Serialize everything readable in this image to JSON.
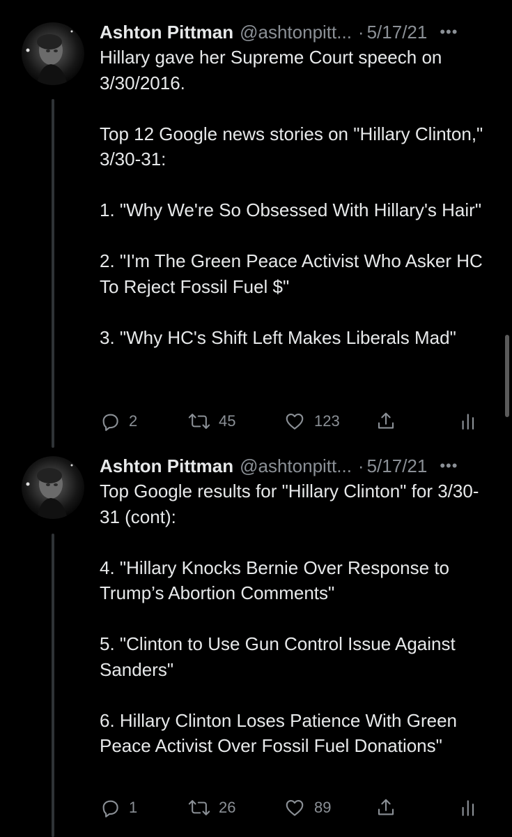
{
  "tweets": [
    {
      "name": "Ashton Pittman",
      "handle": "@ashtonpitt...",
      "separator": "·",
      "date": "5/17/21",
      "more": "•••",
      "paragraphs": [
        "Hillary gave her Supreme Court speech on 3/30/2016.",
        "Top 12 Google news stories on \"Hillary Clinton,\" 3/30-31:",
        "1. \"Why We're So Obsessed With Hillary's Hair\"",
        "2. \"I'm The Green Peace Activist Who Asker HC To Reject Fossil Fuel $\"",
        "3. \"Why HC's Shift Left Makes Liberals Mad\""
      ],
      "replies": "2",
      "retweets": "45",
      "likes": "123"
    },
    {
      "name": "Ashton Pittman",
      "handle": "@ashtonpitt...",
      "separator": "·",
      "date": "5/17/21",
      "more": "•••",
      "paragraphs": [
        "Top Google results for \"Hillary Clinton\" for 3/30-31 (cont):",
        "4. \"Hillary Knocks Bernie Over Response to Trump’s Abortion Comments\"",
        "5. \"Clinton to Use Gun Control Issue Against Sanders\"",
        "6. Hillary Clinton Loses Patience With Green Peace Activist Over Fossil Fuel Donations\""
      ],
      "replies": "1",
      "retweets": "26",
      "likes": "89"
    }
  ],
  "icons": {
    "reply": "reply-icon",
    "retweet": "retweet-icon",
    "like": "heart-icon",
    "share": "share-icon",
    "stats": "analytics-icon"
  },
  "colors": {
    "background": "#000000",
    "text": "#e7e9ea",
    "secondary": "#8b9096",
    "thread_line": "#2f3336"
  }
}
